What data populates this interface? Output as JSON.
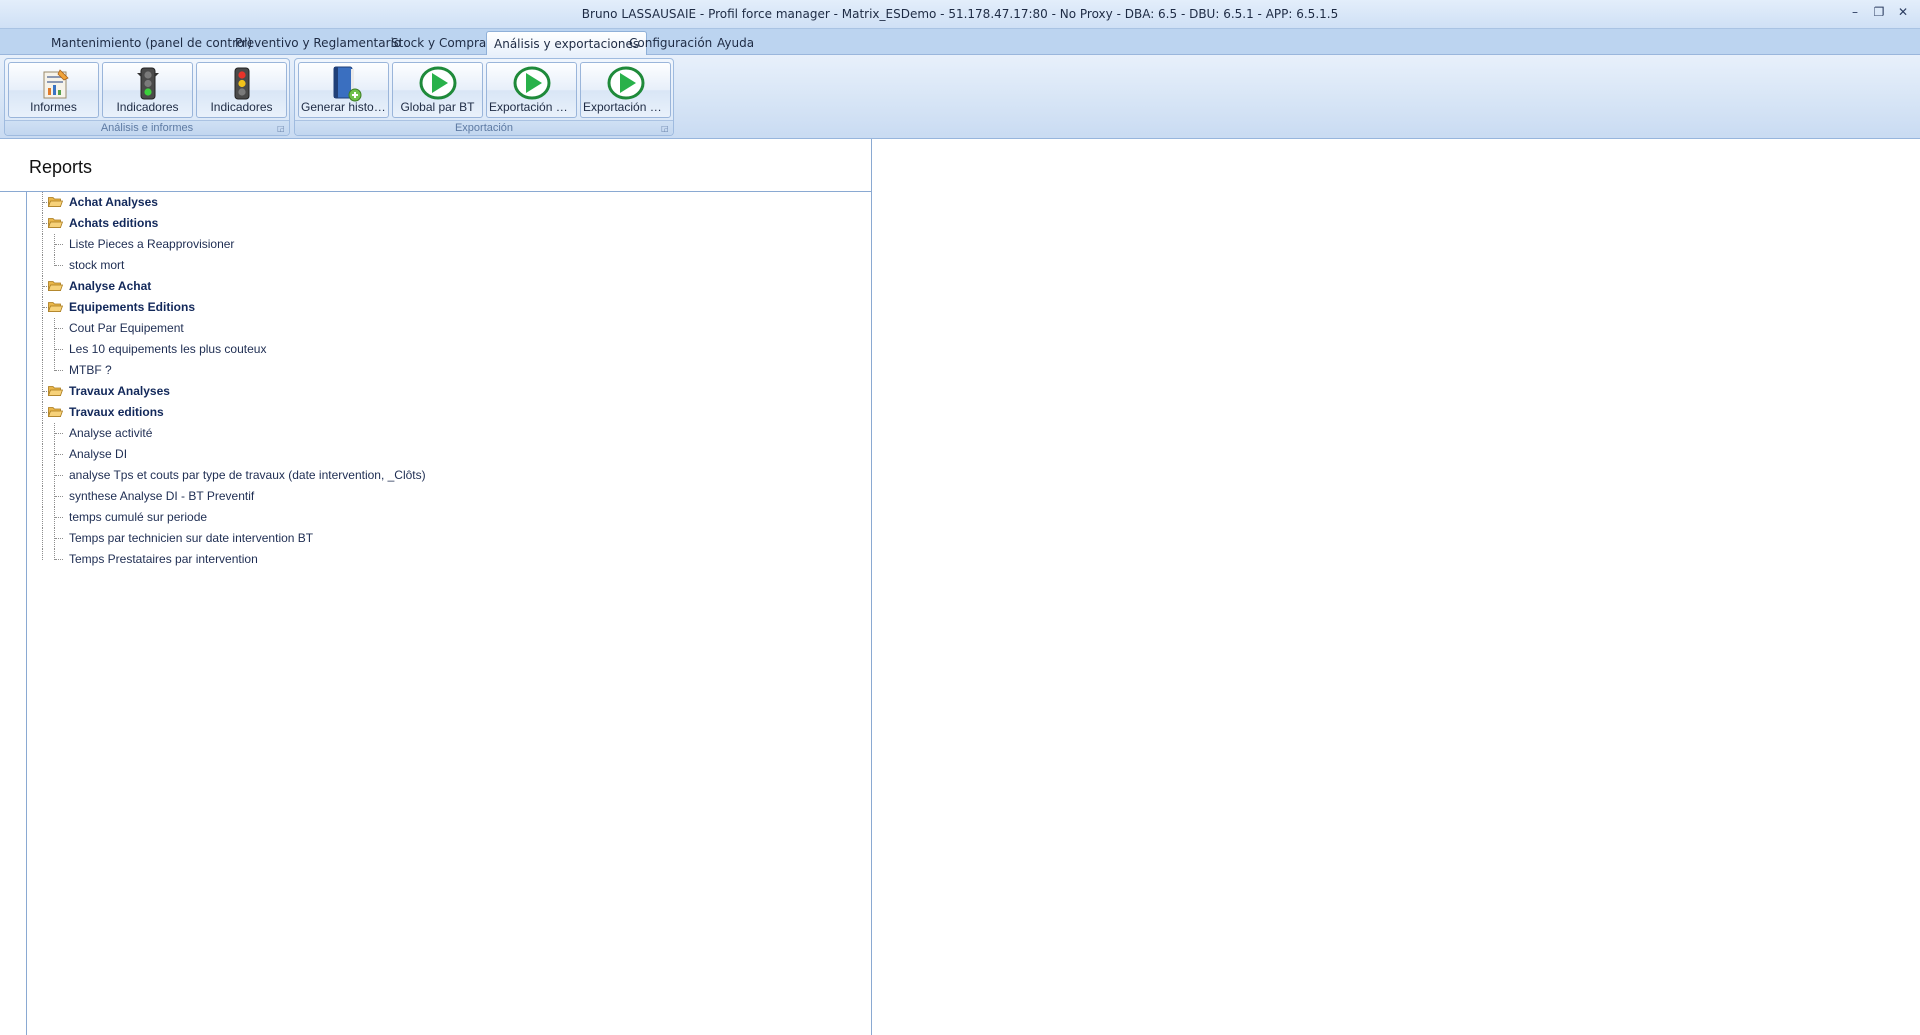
{
  "window": {
    "title": "Bruno LASSAUSAIE - Profil force manager - Matrix_ESDemo - 51.178.47.17:80 - No Proxy - DBA: 6.5 - DBU: 6.5.1 - APP: 6.5.1.5",
    "minimize": "–",
    "maximize": "❐",
    "close": "✕"
  },
  "menu": {
    "tabs": [
      {
        "label": "Mantenimiento (panel de control)"
      },
      {
        "label": "Preventivo y Reglamentario"
      },
      {
        "label": "Stock y Compras"
      },
      {
        "label": "Análisis y exportaciones"
      },
      {
        "label": "Configuración"
      },
      {
        "label": "Ayuda"
      }
    ],
    "active_index": 3
  },
  "ribbon": {
    "groups": [
      {
        "label": "Análisis e informes",
        "buttons": [
          {
            "label": "Informes",
            "icon": "report-icon"
          },
          {
            "label": "Indicadores",
            "icon": "traffic-light-green-icon"
          },
          {
            "label": "Indicadores",
            "icon": "traffic-light-red-icon"
          }
        ]
      },
      {
        "label": "Exportación",
        "buttons": [
          {
            "label": "Generar histori...",
            "icon": "book-add-icon"
          },
          {
            "label": "Global par  BT",
            "icon": "play-icon"
          },
          {
            "label": "Exportación G...",
            "icon": "play-icon"
          },
          {
            "label": "Exportación G...",
            "icon": "play-icon"
          }
        ]
      }
    ]
  },
  "reports": {
    "title": "Reports",
    "tree": [
      {
        "type": "folder",
        "label": "Achat Analyses"
      },
      {
        "type": "folder",
        "label": "Achats editions"
      },
      {
        "type": "leaf",
        "label": "Liste Pieces a Reapprovisioner"
      },
      {
        "type": "leaf",
        "label": "stock mort"
      },
      {
        "type": "folder",
        "label": "Analyse Achat"
      },
      {
        "type": "folder",
        "label": "Equipements Editions"
      },
      {
        "type": "leaf",
        "label": "Cout Par Equipement"
      },
      {
        "type": "leaf",
        "label": "Les 10 equipements les plus couteux"
      },
      {
        "type": "leaf",
        "label": "MTBF ?"
      },
      {
        "type": "folder",
        "label": "Travaux Analyses"
      },
      {
        "type": "folder",
        "label": "Travaux editions"
      },
      {
        "type": "leaf",
        "label": "Analyse activité"
      },
      {
        "type": "leaf",
        "label": "Analyse DI"
      },
      {
        "type": "leaf",
        "label": " analyse Tps et couts par  type de travaux (date intervention, _Clôts)"
      },
      {
        "type": "leaf",
        "label": "synthese Analyse DI - BT Preventif"
      },
      {
        "type": "leaf",
        "label": "temps cumulé sur periode"
      },
      {
        "type": "leaf",
        "label": "Temps par technicien sur date intervention BT"
      },
      {
        "type": "leaf",
        "label": "Temps Prestataires par intervention"
      }
    ]
  }
}
